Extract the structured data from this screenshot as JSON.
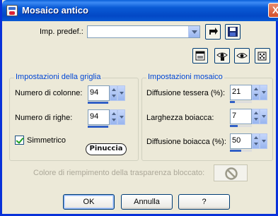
{
  "window": {
    "title": "Mosaico antico",
    "close_label": "X"
  },
  "preset": {
    "label": "Imp. predef.:",
    "value": ""
  },
  "grid_group": {
    "title": "Impostazioni della griglia",
    "columns_label": "Numero di colonne:",
    "columns_value": "94",
    "columns_fill": 0.95,
    "rows_label": "Numero di righe:",
    "rows_value": "94",
    "rows_fill": 0.95,
    "symmetric_label": "Simmetrico",
    "symmetric_checked": true,
    "logo_text": "Pinuccia"
  },
  "mosaic_group": {
    "title": "Impostazioni mosaico",
    "tile_spread_label": "Diffusione tessera (%):",
    "tile_spread_value": "21",
    "tile_spread_fill": 0.21,
    "grout_width_label": "Larghezza boiacca:",
    "grout_width_value": "7",
    "grout_width_fill": 0.35,
    "grout_spread_label": "Diffusione boiacca (%):",
    "grout_spread_value": "50",
    "grout_spread_fill": 0.5
  },
  "transparency": {
    "label": "Colore di riempimento della trasparenza bloccato:"
  },
  "buttons": {
    "ok": "OK",
    "cancel": "Annulla",
    "help": "?"
  },
  "icons": [
    "app-icon",
    "save-preset-icon",
    "disk-icon",
    "preview-toggle-icon",
    "eye-proof-icon",
    "eye-icon",
    "dice-icon",
    "no-sign-icon"
  ]
}
